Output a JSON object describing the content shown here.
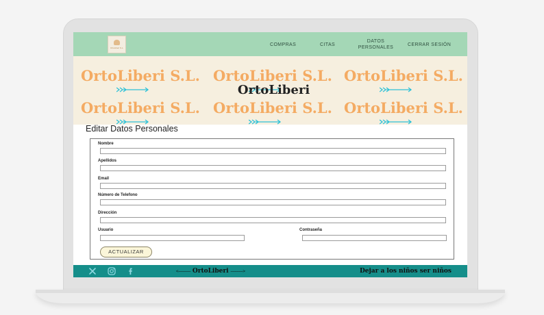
{
  "logo": {
    "text": "OrtoLiberi S.L."
  },
  "nav": {
    "items": [
      {
        "label": "COMPRAS"
      },
      {
        "label": "CITAS"
      },
      {
        "label": "DATOS\nPERSONALES"
      },
      {
        "label": "CERRAR SESIÓN"
      }
    ]
  },
  "banner": {
    "tile_text": "OrtoLiberi S.L.",
    "title": "OrtoLiberi"
  },
  "page": {
    "heading": "Editar Datos Personales"
  },
  "form": {
    "nombre_label": "Nombre",
    "apellidos_label": "Apellidos",
    "email_label": "Email",
    "telefono_label": "Número de Telefono",
    "direccion_label": "Dirección",
    "usuario_label": "Usuario",
    "contrasena_label": "Contraseña",
    "submit_label": "ACTUALIZAR"
  },
  "footer": {
    "social": [
      "x-icon",
      "instagram-icon",
      "facebook-icon"
    ],
    "center_left": "<------------",
    "center_brand": "OrtoLiberi",
    "center_right": "------------>",
    "slogan": "Dejar a los niños ser niños"
  },
  "colors": {
    "navbar": "#a4d7b6",
    "banner_bg": "#f6efdf",
    "banner_text": "#f4ab63",
    "arrows": "#2cc1d8",
    "footer": "#158e8a",
    "button_bg": "#fbf6d9"
  }
}
